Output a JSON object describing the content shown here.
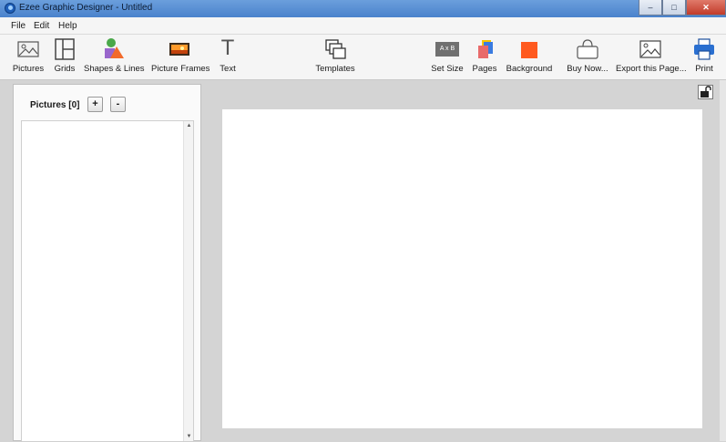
{
  "window": {
    "title": "Ezee Graphic Designer - Untitled",
    "minimize": "–",
    "maximize": "□",
    "close": "✕"
  },
  "menu": {
    "file": "File",
    "edit": "Edit",
    "help": "Help"
  },
  "toolbar": {
    "pictures": "Pictures",
    "grids": "Grids",
    "shapes": "Shapes & Lines",
    "frames": "Picture Frames",
    "text": "Text",
    "text_glyph": "T",
    "templates": "Templates",
    "setsize": "Set Size",
    "setsize_glyph": "A x B",
    "pages": "Pages",
    "background": "Background",
    "buynow": "Buy Now...",
    "export": "Export this Page...",
    "print": "Print"
  },
  "leftpanel": {
    "title": "Pictures [0]",
    "add": "+",
    "remove": "-"
  },
  "colors": {
    "background_swatch": "#ff5a1f",
    "shape_purple": "#9966cc",
    "shape_orange": "#f26a2a",
    "shape_green": "#4aa84a",
    "print_blue": "#2a6fd0"
  }
}
